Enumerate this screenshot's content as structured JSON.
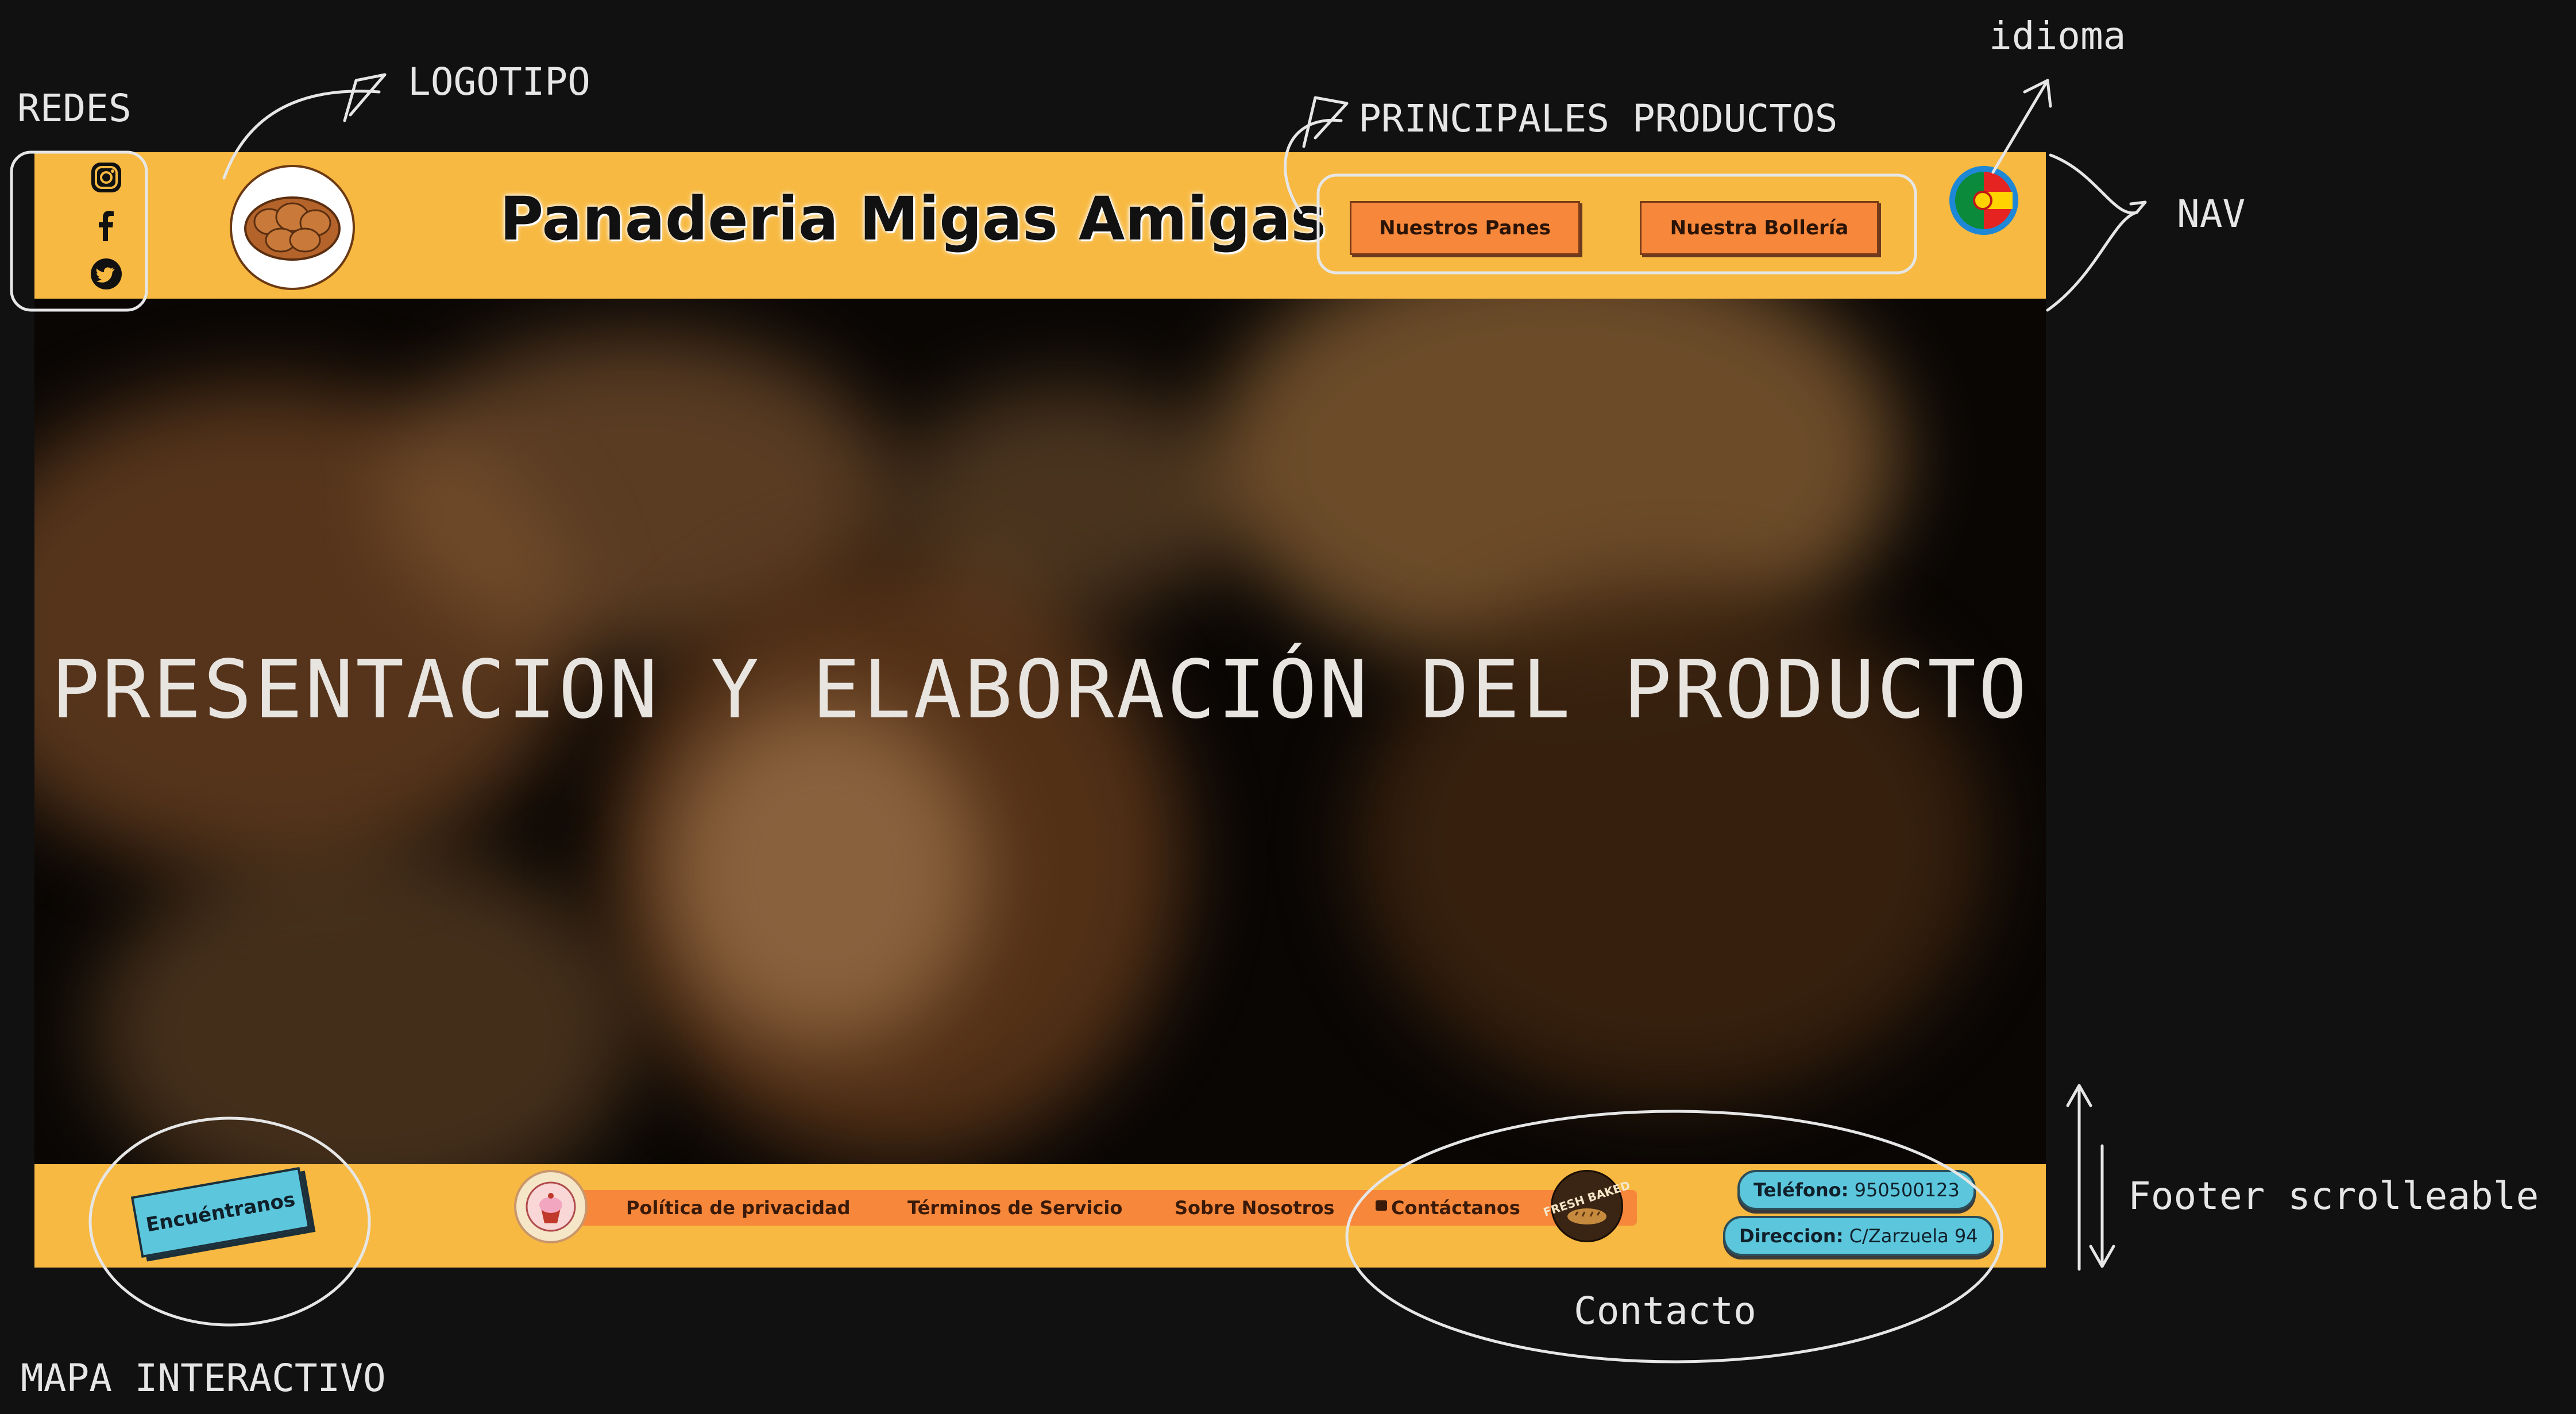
{
  "annotations": {
    "redes": "REDES",
    "logotipo": "LOGOTIPO",
    "principales_productos": "PRINCIPALES PRODUCTOS",
    "idioma": "idioma",
    "nav": "NAV",
    "footer_scrolleable": "Footer scrolleable",
    "contacto": "Contacto",
    "mapa_interactivo": "MAPA INTERACTIVO"
  },
  "nav": {
    "social_icons": [
      "instagram-icon",
      "facebook-icon",
      "twitter-icon"
    ],
    "logo_icon": "bread-loaf-icon",
    "brand_name": "Panaderia Migas Amigas",
    "products": {
      "breads_label": "Nuestros Panes",
      "pastries_label": "Nuestra Bollería"
    },
    "language_icon": "language-flag-icon"
  },
  "hero": {
    "title": "PRESENTACION Y ELABORACIÓN DEL PRODUCTO"
  },
  "footer": {
    "map_button": "Encuéntranos",
    "left_badge_icon": "cupcake-badge-icon",
    "links": {
      "privacy": "Política de privacidad",
      "terms": "Términos de Servicio",
      "about": "Sobre Nosotros",
      "contact": "Contáctanos"
    },
    "right_badge_text": "FRESH BAKED",
    "phone_label": "Teléfono:",
    "phone_value": "950500123",
    "address_label": "Direccion:",
    "address_value": "C/Zarzuela 94"
  },
  "colors": {
    "page_background": "#111111",
    "nav_yellow": "#f7b941",
    "button_orange": "#f7873b",
    "contact_blue": "#5cc6dc",
    "annotation_white": "#e6e6e6"
  }
}
